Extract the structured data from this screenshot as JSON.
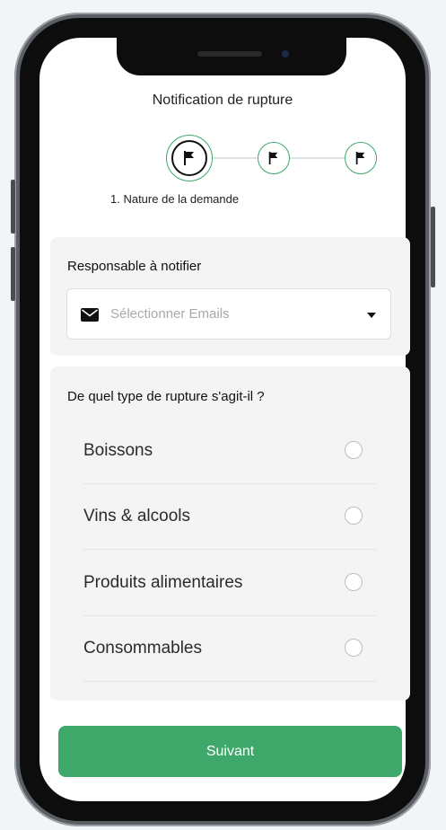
{
  "header": {
    "title": "Notification de rupture"
  },
  "stepper": {
    "steps": [
      {
        "icon": "flag-icon",
        "state": "active"
      },
      {
        "icon": "flag-icon",
        "state": "upcoming"
      },
      {
        "icon": "flag-icon",
        "state": "upcoming"
      }
    ],
    "current_label": "1. Nature de la demande"
  },
  "recipient": {
    "label": "Responsable à notifier",
    "select_placeholder": "Sélectionner Emails",
    "icon": "envelope-icon",
    "dropdown_icon": "caret-down-icon"
  },
  "rupture_type": {
    "question": "De quel type de rupture s'agit-il ?",
    "options": [
      {
        "label": "Boissons",
        "selected": false
      },
      {
        "label": "Vins & alcools",
        "selected": false
      },
      {
        "label": "Produits alimentaires",
        "selected": false
      },
      {
        "label": "Consommables",
        "selected": false
      }
    ]
  },
  "footer": {
    "next_label": "Suivant"
  },
  "colors": {
    "primary": "#3ea86a",
    "step_ring": "#3ea86a",
    "card_bg": "#f4f4f4"
  }
}
